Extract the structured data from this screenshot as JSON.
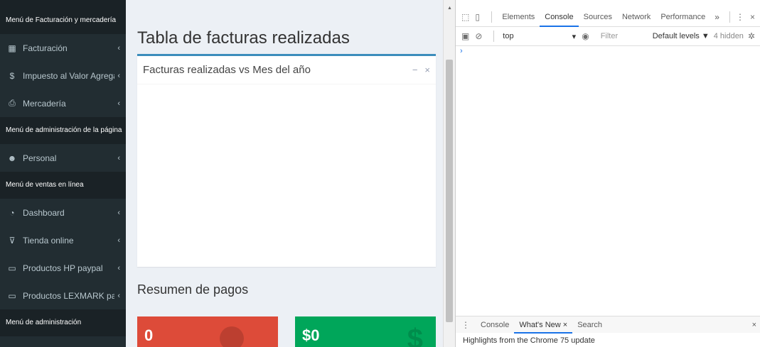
{
  "sidebar": {
    "headers": [
      "Menú de Facturación y mercadería",
      "Menú de administración de la página",
      "Menú de ventas en línea",
      "Menú de administración"
    ],
    "items": [
      {
        "label": "Facturación",
        "icon": "calculator-icon",
        "chevron": "‹"
      },
      {
        "label": "Impuesto al Valor Agregado",
        "icon": "dollar-icon",
        "chevron": "‹"
      },
      {
        "label": "Mercadería",
        "icon": "printer-icon",
        "chevron": "‹"
      },
      {
        "label": "Personal",
        "icon": "users-icon",
        "chevron": "‹"
      },
      {
        "label": "Dashboard",
        "icon": "tachometer-icon",
        "chevron": "‹"
      },
      {
        "label": "Tienda online",
        "icon": "cart-icon",
        "chevron": "‹"
      },
      {
        "label": "Productos HP paypal",
        "icon": "monitor-icon",
        "chevron": "‹"
      },
      {
        "label": "Productos LEXMARK paypal",
        "icon": "monitor-icon",
        "chevron": "‹"
      }
    ]
  },
  "main": {
    "page_title": "Tabla de facturas realizadas",
    "box": {
      "title": "Facturas realizadas vs Mes del año",
      "minimize": "−",
      "close": "×"
    },
    "section_title": "Resumen de pagos",
    "stats": [
      {
        "value": "0",
        "color": "#dd4b39",
        "icon": "circle-icon"
      },
      {
        "value": "$0",
        "color": "#00a65a",
        "icon": "dollar-icon",
        "icon_glyph": "$"
      }
    ]
  },
  "devtools": {
    "tabs": [
      "Elements",
      "Console",
      "Sources",
      "Network",
      "Performance"
    ],
    "active_tab": "Console",
    "more": "»",
    "context": "top",
    "filter_placeholder": "Filter",
    "levels": "Default levels ▼",
    "hidden": "4 hidden",
    "prompt": "›",
    "drawer_tabs": [
      "Console",
      "What's New ×",
      "Search"
    ],
    "drawer_active": "What's New ×",
    "drawer_content": "Highlights from the Chrome 75 update",
    "accent": "#1a73e8"
  }
}
